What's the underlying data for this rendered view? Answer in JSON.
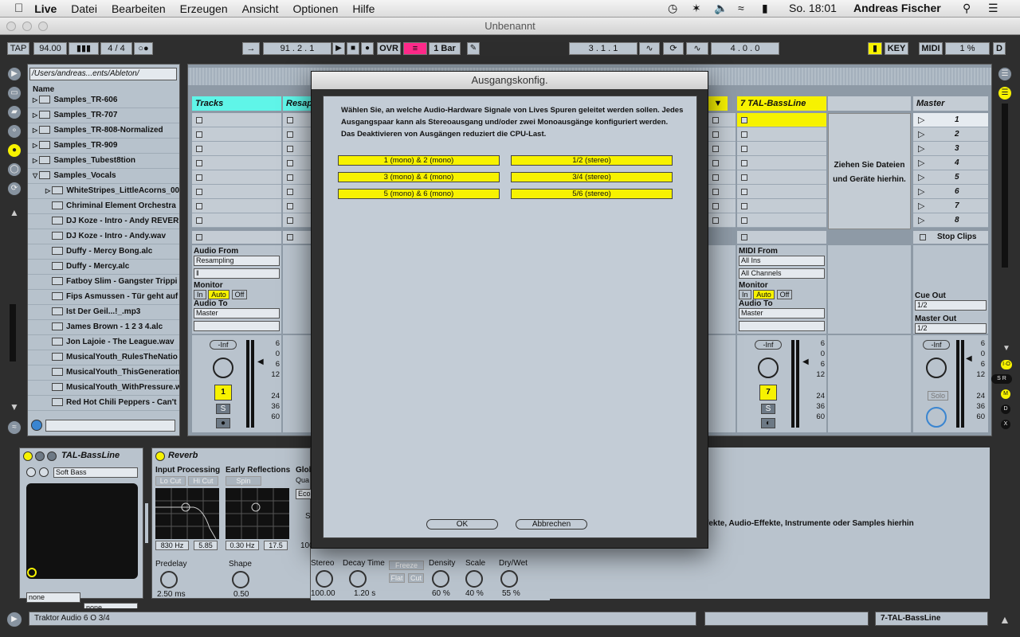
{
  "menubar": {
    "app": "Live",
    "items": [
      "Datei",
      "Bearbeiten",
      "Erzeugen",
      "Ansicht",
      "Optionen",
      "Hilfe"
    ],
    "clock": "So. 18:01",
    "user": "Andreas Fischer"
  },
  "window": {
    "title": "Unbenannt"
  },
  "transport": {
    "tap": "TAP",
    "tempo": "94.00",
    "signature": "4 / 4",
    "position": "91 .  2 .  1",
    "ovr": "OVR",
    "quantize": "1 Bar",
    "loop_start": "3 .  1 .  1",
    "loop_length": "4 .  0 .  0",
    "key": "KEY",
    "midi": "MIDI",
    "cpu": "1 %",
    "d": "D"
  },
  "browser": {
    "path": "/Users/andreas...ents/Ableton/",
    "column": "Name",
    "items": [
      {
        "name": "Samples_TR-606",
        "type": "folder"
      },
      {
        "name": "Samples_TR-707",
        "type": "folder"
      },
      {
        "name": "Samples_TR-808-Normalized",
        "type": "folder"
      },
      {
        "name": "Samples_TR-909",
        "type": "folder"
      },
      {
        "name": "Samples_Tubest8tion",
        "type": "folder"
      },
      {
        "name": "Samples_Vocals",
        "type": "folder-open"
      },
      {
        "name": "WhiteStripes_LittleAcorns_00",
        "type": "file"
      },
      {
        "name": "Chriminal Element Orchestra",
        "type": "wav"
      },
      {
        "name": "DJ Koze - Intro - Andy REVER",
        "type": "wav"
      },
      {
        "name": "DJ Koze - Intro - Andy.wav",
        "type": "wav"
      },
      {
        "name": "Duffy - Mercy Bong.alc",
        "type": "alc"
      },
      {
        "name": "Duffy - Mercy.alc",
        "type": "alc"
      },
      {
        "name": "Fatboy Slim - Gangster Trippi",
        "type": "alc"
      },
      {
        "name": "Fips Asmussen - Tür geht auf",
        "type": "alc"
      },
      {
        "name": "Ist Der Geil...!_.mp3",
        "type": "wav"
      },
      {
        "name": "James Brown - 1 2 3 4.alc",
        "type": "alc"
      },
      {
        "name": "Jon Lajoie - The League.wav",
        "type": "wav"
      },
      {
        "name": "MusicalYouth_RulesTheNatio",
        "type": "wav"
      },
      {
        "name": "MusicalYouth_ThisGeneration",
        "type": "wav"
      },
      {
        "name": "MusicalYouth_WithPressure.w",
        "type": "wav"
      },
      {
        "name": "Red Hot Chili Peppers - Can't",
        "type": "wav"
      }
    ]
  },
  "session": {
    "tracks": [
      {
        "name": "Tracks",
        "color": "#5ff5e8"
      },
      {
        "name": "Resap",
        "color": "#5ff5e8"
      },
      {
        "name": "7 TAL-BassLine",
        "color": "#f7f200"
      },
      {
        "name": "Master",
        "color": "#c4ccd4"
      }
    ],
    "drop_hint": "Ziehen Sie Dateien und Geräte hierhin.",
    "scenes": [
      "1",
      "2",
      "3",
      "4",
      "5",
      "6",
      "7",
      "8"
    ],
    "stop_clips": "Stop Clips",
    "io": {
      "audio_from": "Audio From",
      "resampling": "Resampling",
      "monitor": "Monitor",
      "in": "In",
      "auto": "Auto",
      "off": "Off",
      "audio_to": "Audio To",
      "master": "Master",
      "midi_from": "MIDI From",
      "all_ins": "All Ins",
      "all_channels": "All Channels",
      "cue_out": "Cue Out",
      "cue_val": "1/2",
      "master_out": "Master Out",
      "master_val": "1/2"
    },
    "mixer": {
      "inf": "-Inf",
      "track1": "1",
      "track7": "7",
      "solo_s": "S",
      "solo": "Solo",
      "ticks": [
        "6",
        "0",
        "6",
        "12",
        "24",
        "36",
        "60"
      ]
    }
  },
  "dialog": {
    "title": "Ausgangskonfig.",
    "text": "Wählen Sie, an welche Audio-Hardware Signale von Lives Spuren geleitet werden sollen. Jedes Ausgangspaar kann als Stereoausgang und/oder zwei Monoausgänge konfiguriert werden. Das Deaktivieren von Ausgängen reduziert die CPU-Last.",
    "mono": [
      "1 (mono) & 2 (mono)",
      "3 (mono) & 4 (mono)",
      "5 (mono) & 6 (mono)"
    ],
    "stereo": [
      "1/2 (stereo)",
      "3/4 (stereo)",
      "5/6 (stereo)"
    ],
    "ok": "OK",
    "cancel": "Abbrechen"
  },
  "devices": {
    "tal": {
      "name": "TAL-BassLine",
      "preset": "Soft Bass",
      "none1": "none",
      "none2": "none"
    },
    "reverb": {
      "name": "Reverb",
      "input": "Input Processing",
      "lo_cut": "Lo Cut",
      "hi_cut": "Hi Cut",
      "early": "Early Reflections",
      "spin": "Spin",
      "glob": "Glob",
      "quality": "Qua",
      "eco": "Eco",
      "freq": "830 Hz",
      "width": "5.85",
      "er_rate": "0.30 Hz",
      "er_amt": "17.5",
      "predelay": "Predelay",
      "predelay_v": "2.50 ms",
      "shape": "Shape",
      "shape_v": "0.50",
      "stereo": "Stereo",
      "stereo_v": "100.00",
      "decay": "Decay Time",
      "decay_v": "1.20 s",
      "freeze": "Freeze",
      "flat": "Flat",
      "cut": "Cut",
      "density": "Density",
      "density_v": "60 %",
      "scale": "Scale",
      "scale_v": "40 %",
      "drywet": "Dry/Wet",
      "drywet_v": "55 %",
      "s_lbl": "S",
      "val100": "100"
    },
    "drop_hint": "fekte, Audio-Effekte, Instrumente oder Samples hierhin"
  },
  "status": {
    "info": "Traktor Audio 6 O 3/4",
    "track": "7-TAL-BassLine"
  },
  "colors": {
    "yellow": "#f7f200",
    "cyan": "#5ff5e8",
    "panel": "#b9c3cd"
  }
}
